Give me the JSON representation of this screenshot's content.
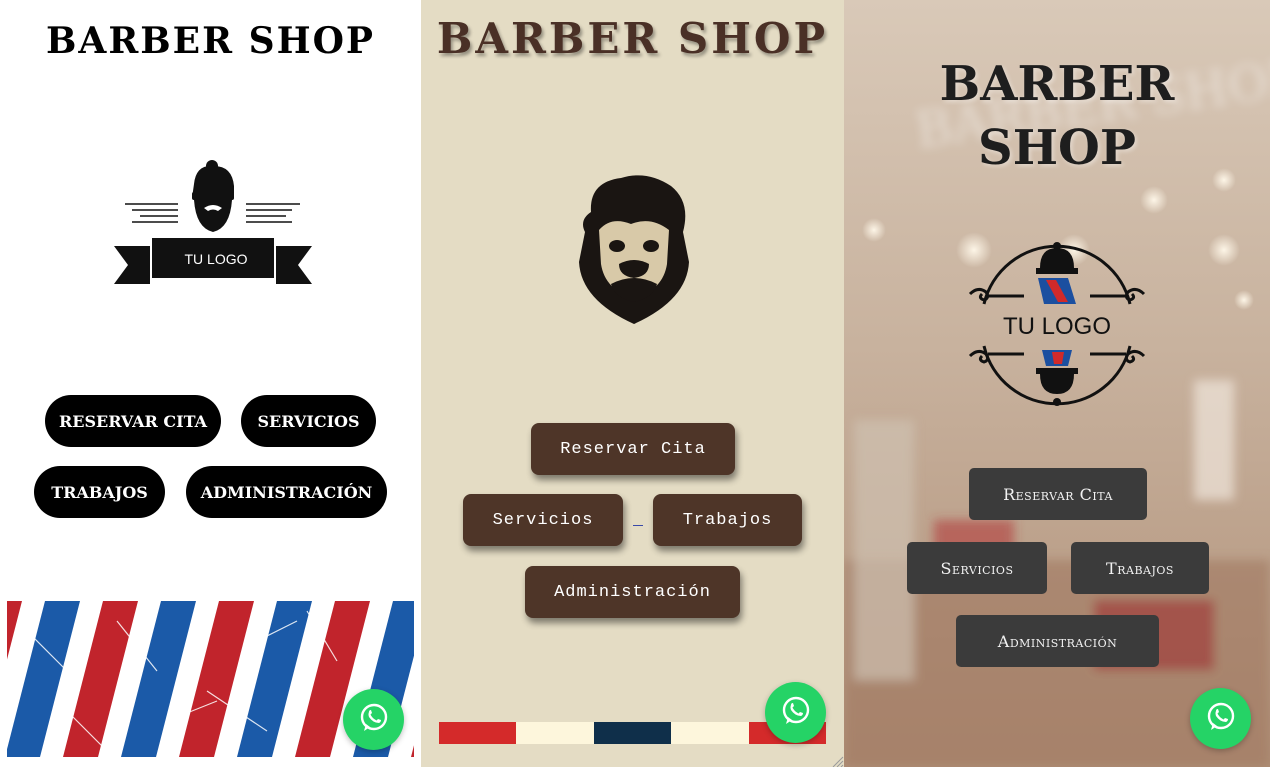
{
  "panel1": {
    "title": "BARBER SHOP",
    "logo_text": "TU LOGO",
    "buttons": {
      "reservar": "RESERVAR CITA",
      "servicios": "SERVICIOS",
      "trabajos": "TRABAJOS",
      "admin": "ADMINISTRACIÓN"
    }
  },
  "panel2": {
    "title": "BARBER SHOP",
    "buttons": {
      "reservar": "Reservar Cita",
      "servicios": "Servicios",
      "trabajos": "Trabajos",
      "admin": "Administración"
    },
    "flag_colors": [
      "#d42a2a",
      "#fdf6dc",
      "#0f2f4a",
      "#fdf6dc",
      "#d42a2a"
    ]
  },
  "panel3": {
    "title_line1": "BARBER",
    "title_line2": "SHOP",
    "logo_text": "TU LOGO",
    "buttons": {
      "reservar": "Reservar Cita",
      "servicios": "Servicios",
      "trabajos": "Trabajos",
      "admin": "Administración"
    }
  },
  "colors": {
    "whatsapp": "#25d366",
    "panel2_bg": "#e4dcc4",
    "panel2_button": "#4e3528",
    "panel3_button": "#3b3b3b",
    "pole_red": "#c1242c",
    "pole_blue": "#1b5aa8"
  },
  "icons": {
    "whatsapp": "whatsapp-icon"
  }
}
